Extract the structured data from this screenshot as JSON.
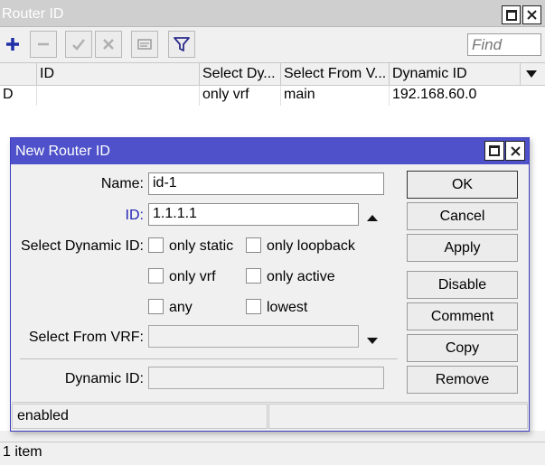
{
  "window": {
    "title": "Router ID"
  },
  "toolbar": {
    "find_placeholder": "Find",
    "icons": [
      "plus-icon",
      "minus-icon",
      "check-icon",
      "cross-icon",
      "comment-icon",
      "filter-icon"
    ]
  },
  "table": {
    "columns": [
      "",
      "ID",
      "Select Dy...",
      "Select From V...",
      "Dynamic ID"
    ],
    "rows": [
      {
        "flag": "D",
        "id": "",
        "select_dynamic": "only vrf",
        "select_from_vrf": "main",
        "dynamic_id": "192.168.60.0"
      }
    ]
  },
  "status": {
    "count": "1 item"
  },
  "dialog": {
    "title": "New Router ID",
    "name_label": "Name:",
    "name_value": "id-1",
    "id_label": "ID:",
    "id_value": "1.1.1.1",
    "select_dynamic_label": "Select Dynamic ID:",
    "options": {
      "only_static": "only static",
      "only_loopback": "only loopback",
      "only_vrf": "only vrf",
      "only_active": "only active",
      "any": "any",
      "lowest": "lowest"
    },
    "select_vrf_label": "Select From VRF:",
    "select_vrf_value": "",
    "dynamic_id_label": "Dynamic ID:",
    "dynamic_id_value": "",
    "buttons": {
      "ok": "OK",
      "cancel": "Cancel",
      "apply": "Apply",
      "disable": "Disable",
      "comment": "Comment",
      "copy": "Copy",
      "remove": "Remove"
    },
    "status_text": "enabled",
    "status_text_2": ""
  },
  "colors": {
    "dialog_titlebar": "#4e51c9",
    "id_label": "#2323b5",
    "accent_plus": "#1f2fa8"
  }
}
